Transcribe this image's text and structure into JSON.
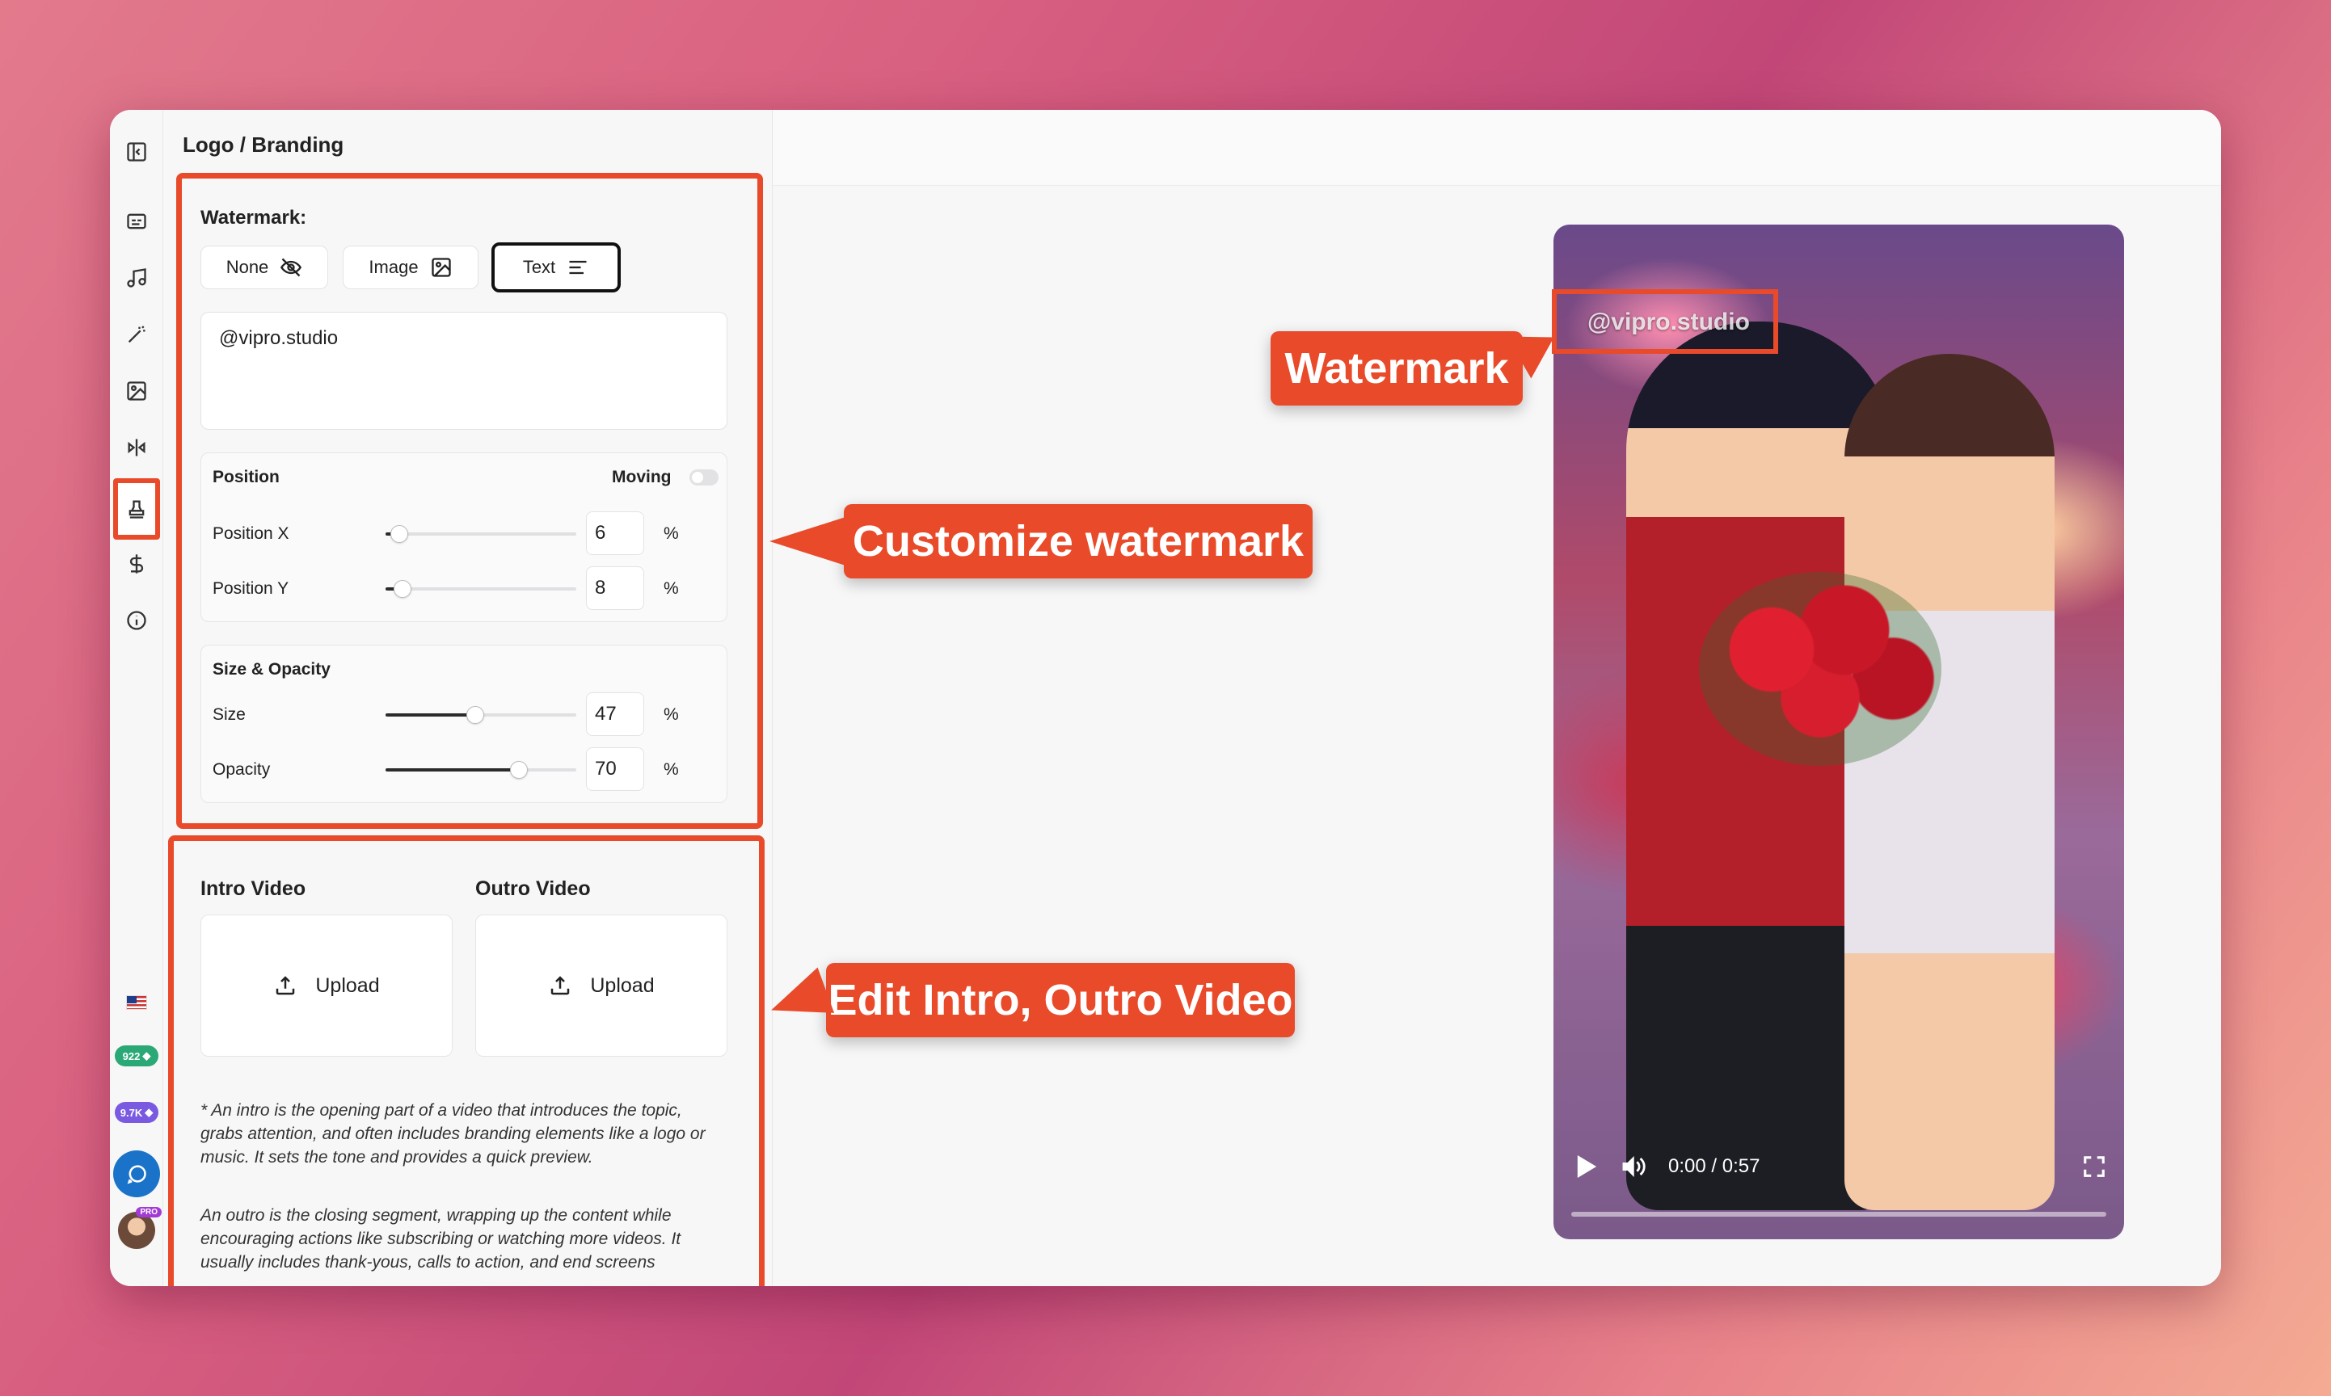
{
  "panel": {
    "title": "Logo / Branding",
    "watermark_label": "Watermark:",
    "watermark_buttons": [
      {
        "label": "None",
        "icon": "eye-off-icon"
      },
      {
        "label": "Image",
        "icon": "image-icon"
      },
      {
        "label": "Text",
        "icon": "text-lines-icon",
        "selected": true
      }
    ],
    "watermark_text": "@vipro.studio",
    "position": {
      "title": "Position",
      "moving_label": "Moving",
      "moving_enabled": false,
      "x_label": "Position X",
      "x_value": "6",
      "y_label": "Position Y",
      "y_value": "8",
      "unit": "%"
    },
    "size_opacity": {
      "title": "Size & Opacity",
      "size_label": "Size",
      "size_value": "47",
      "opacity_label": "Opacity",
      "opacity_value": "70",
      "unit": "%"
    },
    "intro": {
      "title": "Intro Video",
      "upload_label": "Upload"
    },
    "outro": {
      "title": "Outro Video",
      "upload_label": "Upload"
    },
    "note_intro": "* An intro is the opening part of a video that introduces the topic, grabs attention, and often includes branding elements like a logo or music. It sets the tone and provides a quick preview.",
    "note_outro": "An outro is the closing segment, wrapping up the content while encouraging actions like subscribing or watching more videos. It usually includes thank-yous, calls to action, and end screens"
  },
  "rail": {
    "badge_green": "922",
    "badge_purple": "9.7K",
    "avatar_badge": "PRO"
  },
  "video": {
    "watermark_overlay": "@vipro.studio",
    "time": "0:00 / 0:57",
    "progress": 0
  },
  "callouts": {
    "watermark": "Watermark",
    "customize": "Customize watermark",
    "intro_outro": "Edit Intro, Outro Video"
  },
  "colors": {
    "accent": "#e84a2a",
    "chat_button": "#1a73c8",
    "badge_green": "#2aa876",
    "badge_purple": "#7a5ae0"
  }
}
